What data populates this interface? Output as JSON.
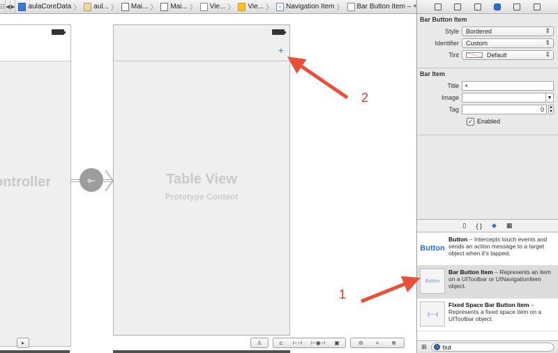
{
  "jumpbar": {
    "crumbs": [
      {
        "label": "aulaCoreData",
        "icon": "project-icon"
      },
      {
        "label": "aul...",
        "icon": "folder-icon"
      },
      {
        "label": "Mai...",
        "icon": "storyboard-file-icon"
      },
      {
        "label": "Mai...",
        "icon": "storyboard-file-icon"
      },
      {
        "label": "Vie...",
        "icon": "scene-icon"
      },
      {
        "label": "Vie...",
        "icon": "view-controller-icon"
      },
      {
        "label": "Navigation Item",
        "icon": "navigation-item-icon"
      },
      {
        "label": "Bar Button Item – +",
        "icon": "bar-button-item-icon"
      }
    ]
  },
  "canvas": {
    "left_scene_title": "ontroller",
    "table_title": "Table View",
    "table_subtitle": "Prototype Content",
    "plus_label": "+"
  },
  "annotations": {
    "one": "1",
    "two": "2",
    "arrow_color": "#e8503a"
  },
  "inspector": {
    "bar_button_item": {
      "title": "Bar Button Item",
      "style_label": "Style",
      "style_value": "Bordered",
      "identifier_label": "Identifier",
      "identifier_value": "Custom",
      "tint_label": "Tint",
      "tint_value": "Default"
    },
    "bar_item": {
      "title": "Bar Item",
      "title_label": "Title",
      "title_value": "+",
      "image_label": "Image",
      "image_value": "",
      "tag_label": "Tag",
      "tag_value": "0",
      "enabled_label": "Enabled",
      "enabled_checked": true
    },
    "library_tabs": [
      "file-template-icon",
      "code-snippet-icon",
      "object-library-icon",
      "media-library-icon"
    ],
    "library_items": [
      {
        "preview": "Button",
        "name": "Button",
        "description": " – Intercepts touch events and sends an action message to a target object when it's tapped."
      },
      {
        "preview": "Button",
        "name": "Bar Button Item",
        "description": " – Represents an item on a UIToolbar or UINavigationItem object."
      },
      {
        "preview": "",
        "name": "Fixed Space Bar Button Item",
        "description": " – Represents a fixed space item on a UIToolbar object."
      }
    ],
    "filter_value": "but"
  }
}
